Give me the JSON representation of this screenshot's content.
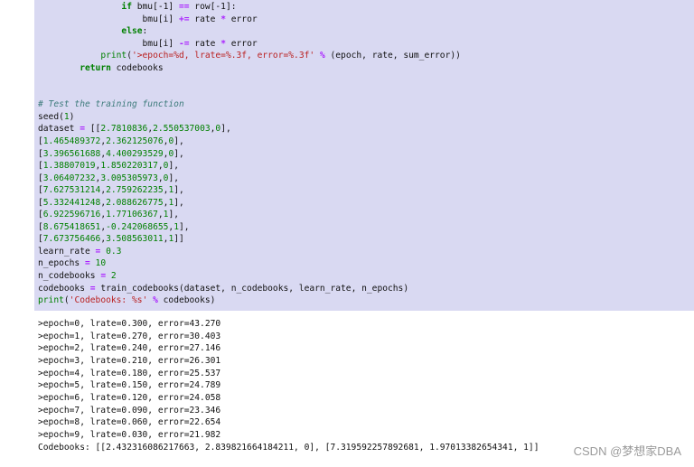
{
  "code": {
    "line1": {
      "indent": "                ",
      "kw_if": "if",
      "a": " bmu[-1] ",
      "op_eq": "==",
      "b": " row[-1]:"
    },
    "line2": {
      "indent": "                    ",
      "a": "bmu[i] ",
      "op": "+=",
      "b": " rate ",
      "op2": "*",
      "c": " error"
    },
    "line3": {
      "indent": "                ",
      "kw_else": "else",
      "b": ":"
    },
    "line4": {
      "indent": "                    ",
      "a": "bmu[i] ",
      "op": "-=",
      "b": " rate ",
      "op2": "*",
      "c": " error"
    },
    "line5": {
      "indent": "            ",
      "bi_print": "print",
      "a": "(",
      "str": "'>epoch=%d, lrate=%.3f, error=%.3f'",
      "b": " ",
      "op": "%",
      "c": " (epoch, rate, sum_error))"
    },
    "line6": {
      "indent": "        ",
      "kw_return": "return",
      "a": " codebooks"
    },
    "comment": "# Test the training function",
    "seed": {
      "fn": "seed",
      "a": "(",
      "n": "1",
      "b": ")"
    },
    "dataset_head": {
      "a": "dataset ",
      "op": "=",
      "b": " [["
    },
    "dataset": [
      [
        "2.7810836",
        "2.550537003",
        "0"
      ],
      [
        "1.465489372",
        "2.362125076",
        "0"
      ],
      [
        "3.396561688",
        "4.400293529",
        "0"
      ],
      [
        "1.38807019",
        "1.850220317",
        "0"
      ],
      [
        "3.06407232",
        "3.005305973",
        "0"
      ],
      [
        "7.627531214",
        "2.759262235",
        "1"
      ],
      [
        "5.332441248",
        "2.088626775",
        "1"
      ],
      [
        "6.922596716",
        "1.77106367",
        "1"
      ],
      [
        "8.675418651",
        "-0.242068655",
        "1"
      ],
      [
        "7.673756466",
        "3.508563011",
        "1"
      ]
    ],
    "learn_rate": {
      "a": "learn_rate ",
      "op": "=",
      "n": " 0.3"
    },
    "n_epochs": {
      "a": "n_epochs ",
      "op": "=",
      "n": " 10"
    },
    "n_codebooks": {
      "a": "n_codebooks ",
      "op": "=",
      "n": " 2"
    },
    "call": {
      "a": "codebooks ",
      "op": "=",
      "b": " train_codebooks(dataset, n_codebooks, learn_rate, n_epochs)"
    },
    "final_print": {
      "bi_print": "print",
      "a": "(",
      "str": "'Codebooks: %s'",
      "b": " ",
      "op": "%",
      "c": " codebooks)"
    }
  },
  "output": [
    ">epoch=0, lrate=0.300, error=43.270",
    ">epoch=1, lrate=0.270, error=30.403",
    ">epoch=2, lrate=0.240, error=27.146",
    ">epoch=3, lrate=0.210, error=26.301",
    ">epoch=4, lrate=0.180, error=25.537",
    ">epoch=5, lrate=0.150, error=24.789",
    ">epoch=6, lrate=0.120, error=24.058",
    ">epoch=7, lrate=0.090, error=23.346",
    ">epoch=8, lrate=0.060, error=22.654",
    ">epoch=9, lrate=0.030, error=21.982",
    "Codebooks: [[2.432316086217663, 2.839821664184211, 0], [7.319592257892681, 1.97013382654341, 1]]"
  ],
  "watermark": "CSDN @梦想家DBA",
  "colors": {
    "cell_bg": "#d9d9f2",
    "keyword": "#008000",
    "operator": "#aa22ff",
    "string": "#ba2121",
    "comment": "#3d7b7b"
  }
}
